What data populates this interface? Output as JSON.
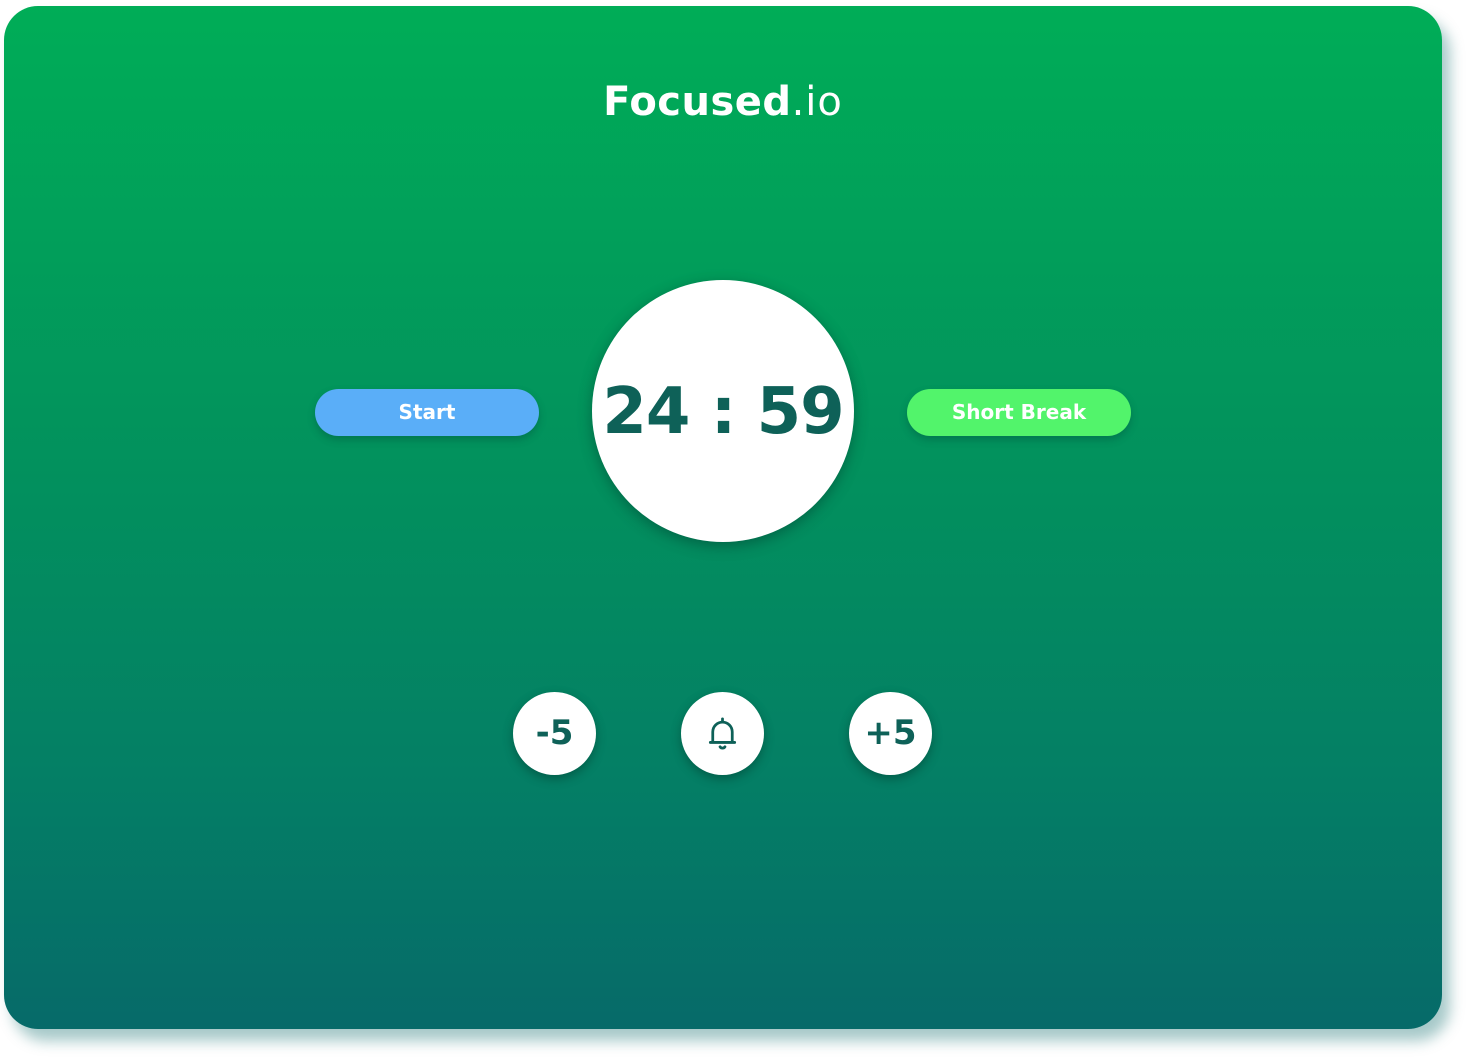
{
  "app": {
    "title_main": "Focused",
    "title_sub": ".io"
  },
  "controls": {
    "start_label": "Start",
    "short_break_label": "Short Break",
    "minus_label": "-5",
    "plus_label": "+5",
    "bell_icon": "bell-icon"
  },
  "timer": {
    "display": "24 : 59"
  },
  "colors": {
    "gradient_top": "#00ad57",
    "gradient_bottom": "#066a69",
    "start_button": "#5aaef8",
    "short_break_button": "#52f46b",
    "timer_text": "#0e6158"
  }
}
